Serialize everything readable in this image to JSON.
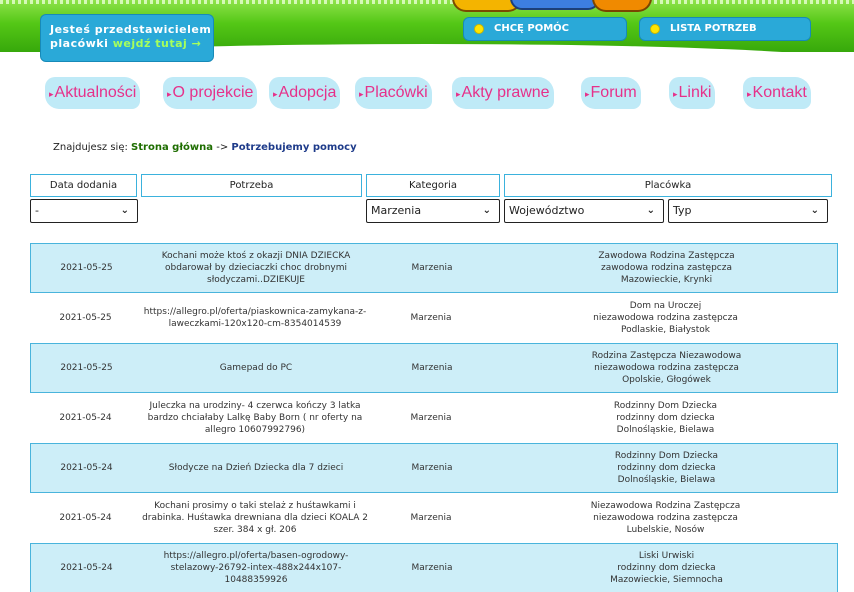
{
  "header": {
    "rep_line1": "Jesteś przedstawicielem",
    "rep_line2_prefix": "placówki",
    "rep_line2_link": "wejdź tutaj",
    "rep_arrow": "→",
    "help_label": "CHCĘ POMÓC",
    "needs_label": "LISTA POTRZEB",
    "accent_green": "#37a80b",
    "accent_blue": "#2aa9d8",
    "nav_pink": "#e6318a"
  },
  "nav": {
    "bullet": "▸",
    "items": [
      "Aktualności",
      "O projekcie",
      "Adopcja",
      "Placówki",
      "Akty prawne",
      "Forum",
      "Linki",
      "Kontakt"
    ]
  },
  "breadcrumb": {
    "prefix": "Znajdujesz się:",
    "home": "Strona główna",
    "sep": "->",
    "current": "Potrzebujemy pomocy"
  },
  "filters": {
    "headers": {
      "date": "Data dodania",
      "need": "Potrzeba",
      "category": "Kategoria",
      "facility": "Placówka"
    },
    "selects": {
      "date": "-",
      "category": "Marzenia",
      "region": "Województwo",
      "type": "Typ"
    },
    "chevron": "⌄"
  },
  "rows": [
    {
      "date": "2021-05-25",
      "need": "Kochani może ktoś z okazji DNIA DZIECKA obdarował by dzieciaczki choc drobnymi słodyczami..DZIEKUJE",
      "category": "Marzenia",
      "f1": "Zawodowa Rodzina Zastępcza",
      "f2": "zawodowa rodzina zastępcza",
      "f3": "Mazowieckie, Krynki"
    },
    {
      "date": "2021-05-25",
      "need": "https://allegro.pl/oferta/piaskownica-zamykana-z-laweczkami-120x120-cm-8354014539",
      "category": "Marzenia",
      "f1": "Dom na Uroczej",
      "f2": "niezawodowa rodzina zastępcza",
      "f3": "Podlaskie, Białystok"
    },
    {
      "date": "2021-05-25",
      "need": "Gamepad do PC",
      "category": "Marzenia",
      "f1": "Rodzina Zastępcza Niezawodowa",
      "f2": "niezawodowa rodzina zastępcza",
      "f3": "Opolskie, Głogówek"
    },
    {
      "date": "2021-05-24",
      "need": "Juleczka na urodziny- 4 czerwca kończy 3 latka bardzo chciałaby Lalkę Baby Born ( nr oferty na allegro 10607992796)",
      "category": "Marzenia",
      "f1": "Rodzinny Dom Dziecka",
      "f2": "rodzinny dom dziecka",
      "f3": "Dolnośląskie, Bielawa"
    },
    {
      "date": "2021-05-24",
      "need": "Słodycze na Dzień Dziecka dla 7 dzieci",
      "category": "Marzenia",
      "f1": "Rodzinny Dom Dziecka",
      "f2": "rodzinny dom dziecka",
      "f3": "Dolnośląskie, Bielawa"
    },
    {
      "date": "2021-05-24",
      "need": "Kochani prosimy o taki stelaż z huśtawkami i drabinka. Huśtawka drewniana dla dzieci KOALA 2 szer. 384 x gł. 206",
      "category": "Marzenia",
      "f1": "Niezawodowa Rodzina Zastępcza",
      "f2": "niezawodowa rodzina zastępcza",
      "f3": "Lubelskie, Nosów"
    },
    {
      "date": "2021-05-24",
      "need": "https://allegro.pl/oferta/basen-ogrodowy-stelazowy-26792-intex-488x244x107-10488359926",
      "category": "Marzenia",
      "f1": "Liski Urwiski",
      "f2": "rodzinny dom dziecka",
      "f3": "Mazowieckie, Siemnocha"
    }
  ]
}
